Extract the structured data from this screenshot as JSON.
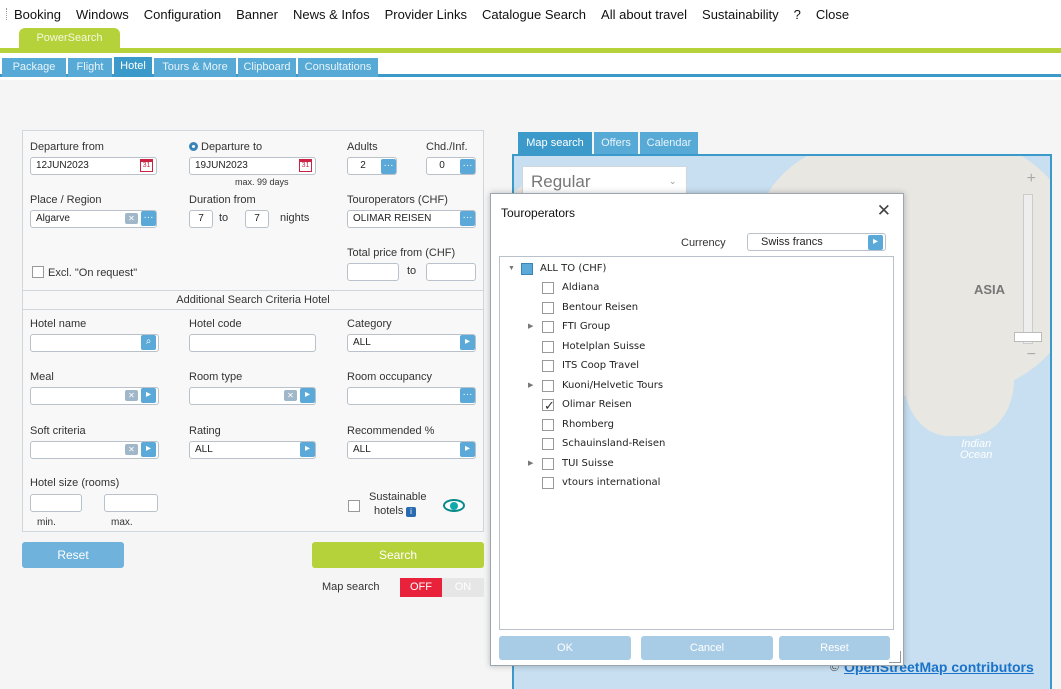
{
  "menu": [
    "Booking",
    "Windows",
    "Configuration",
    "Banner",
    "News & Infos",
    "Provider Links",
    "Catalogue Search",
    "All about travel",
    "Sustainability",
    "?",
    "Close"
  ],
  "main_tab": "PowerSearch",
  "sub_tabs": [
    "Package",
    "Flight",
    "Hotel",
    "Tours & More",
    "Clipboard",
    "Consultations"
  ],
  "form": {
    "departure_from_label": "Departure from",
    "departure_from_value": "12JUN2023",
    "departure_to_label": "Departure to",
    "departure_to_value": "19JUN2023",
    "max_days": "max. 99 days",
    "adults_label": "Adults",
    "adults_value": "2",
    "chd_label": "Chd./Inf.",
    "chd_value": "0",
    "place_label": "Place / Region",
    "place_value": "Algarve",
    "duration_label": "Duration from",
    "duration_from": "7",
    "duration_to_word": "to",
    "duration_to": "7",
    "nights_word": "nights",
    "touroperators_label": "Touroperators (CHF)",
    "touroperators_value": "OLIMAR REISEN",
    "total_price_label": "Total price from (CHF)",
    "price_to_word": "to",
    "excl_label": "Excl. \"On request\"",
    "additional_title": "Additional Search Criteria Hotel",
    "hotel_name_label": "Hotel name",
    "hotel_code_label": "Hotel code",
    "category_label": "Category",
    "category_value": "ALL",
    "meal_label": "Meal",
    "room_type_label": "Room type",
    "room_occupancy_label": "Room occupancy",
    "soft_criteria_label": "Soft criteria",
    "rating_label": "Rating",
    "rating_value": "ALL",
    "recommended_label": "Recommended %",
    "recommended_value": "ALL",
    "hotel_size_label": "Hotel size (rooms)",
    "min_label": "min.",
    "max_label": "max.",
    "sustainable_line1": "Sustainable",
    "sustainable_line2": "hotels"
  },
  "actions": {
    "reset": "Reset",
    "search": "Search",
    "map_search_label": "Map search",
    "toggle_off": "OFF",
    "toggle_on": "ON"
  },
  "map": {
    "tabs": [
      "Map search",
      "Offers",
      "Calendar"
    ],
    "style_select": "Regular",
    "region_label": "ASIA",
    "ocean_line1": "Indian",
    "ocean_line2": "Ocean",
    "attribution_symbol": "©",
    "attribution": "OpenStreetMap contributors",
    "zoom_in": "+",
    "zoom_out": "−"
  },
  "dialog": {
    "title": "Touroperators",
    "currency_label": "Currency",
    "currency_value": "Swiss francs",
    "root": "ALL TO (CHF)",
    "items": [
      {
        "label": "Aldiana",
        "expandable": false,
        "checked": false
      },
      {
        "label": "Bentour Reisen",
        "expandable": false,
        "checked": false
      },
      {
        "label": "FTI Group",
        "expandable": true,
        "checked": false
      },
      {
        "label": "Hotelplan Suisse",
        "expandable": false,
        "checked": false
      },
      {
        "label": "ITS Coop Travel",
        "expandable": false,
        "checked": false
      },
      {
        "label": "Kuoni/Helvetic Tours",
        "expandable": true,
        "checked": false
      },
      {
        "label": "Olimar Reisen",
        "expandable": false,
        "checked": true
      },
      {
        "label": "Rhomberg",
        "expandable": false,
        "checked": false
      },
      {
        "label": "Schauinsland-Reisen",
        "expandable": false,
        "checked": false
      },
      {
        "label": "TUI Suisse",
        "expandable": true,
        "checked": false
      },
      {
        "label": "vtours international",
        "expandable": false,
        "checked": false
      }
    ],
    "ok": "OK",
    "cancel": "Cancel",
    "reset": "Reset"
  },
  "colors": {
    "green": "#b6d23a",
    "blue": "#3b9ac9",
    "red": "#e8223a"
  }
}
